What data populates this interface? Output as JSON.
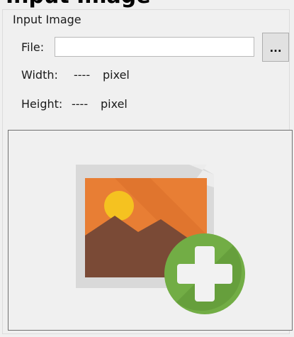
{
  "group": {
    "title": "Input Image",
    "clipped_heading": "Input Image"
  },
  "file": {
    "label": "File:",
    "value": "",
    "placeholder": "",
    "browse_label": "..."
  },
  "width": {
    "label": "Width:",
    "value": "----",
    "unit": "pixel"
  },
  "height": {
    "label": "Height:",
    "value": "----",
    "unit": "pixel"
  },
  "preview": {
    "icon": "add-image-icon",
    "colors": {
      "frame": "#d8d8d8",
      "picture_bg": "#e87e34",
      "sun": "#f5c220",
      "mountains": "#7a4a36",
      "plus_circle": "#72ad45",
      "plus": "#ffffff"
    }
  }
}
